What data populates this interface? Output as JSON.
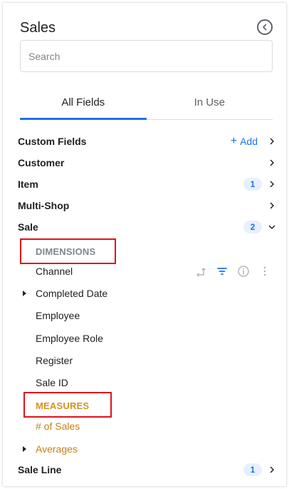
{
  "header": {
    "title": "Sales"
  },
  "search": {
    "placeholder": "Search"
  },
  "tabs": [
    {
      "label": "All Fields",
      "active": true
    },
    {
      "label": "In Use",
      "active": false
    }
  ],
  "groups": {
    "custom_fields": {
      "label": "Custom Fields",
      "add_label": "Add",
      "add_icon": "+"
    },
    "customer": {
      "label": "Customer"
    },
    "item": {
      "label": "Item",
      "badge": "1"
    },
    "multi_shop": {
      "label": "Multi-Shop"
    },
    "sale": {
      "label": "Sale",
      "badge": "2",
      "expanded": true,
      "dimensions_label": "DIMENSIONS",
      "dimensions": [
        {
          "label": "Channel",
          "expandable": false
        },
        {
          "label": "Completed Date",
          "expandable": true
        },
        {
          "label": "Employee",
          "expandable": false
        },
        {
          "label": "Employee Role",
          "expandable": false
        },
        {
          "label": "Register",
          "expandable": false
        },
        {
          "label": "Sale ID",
          "expandable": false
        }
      ],
      "measures_label": "MEASURES",
      "measures": [
        {
          "label": "# of Sales",
          "expandable": false
        },
        {
          "label": "Averages",
          "expandable": true
        }
      ]
    },
    "sale_line": {
      "label": "Sale Line",
      "badge": "1"
    }
  },
  "colors": {
    "accent": "#1a73e8",
    "dimension_label": "#80868b",
    "measure": "#c77f14",
    "highlight": "#e0121c"
  },
  "icons": {
    "collapse": "chevron-left-circle-icon",
    "row_actions": [
      "pivot-icon",
      "filter-icon",
      "info-icon",
      "more-vertical-icon"
    ]
  }
}
